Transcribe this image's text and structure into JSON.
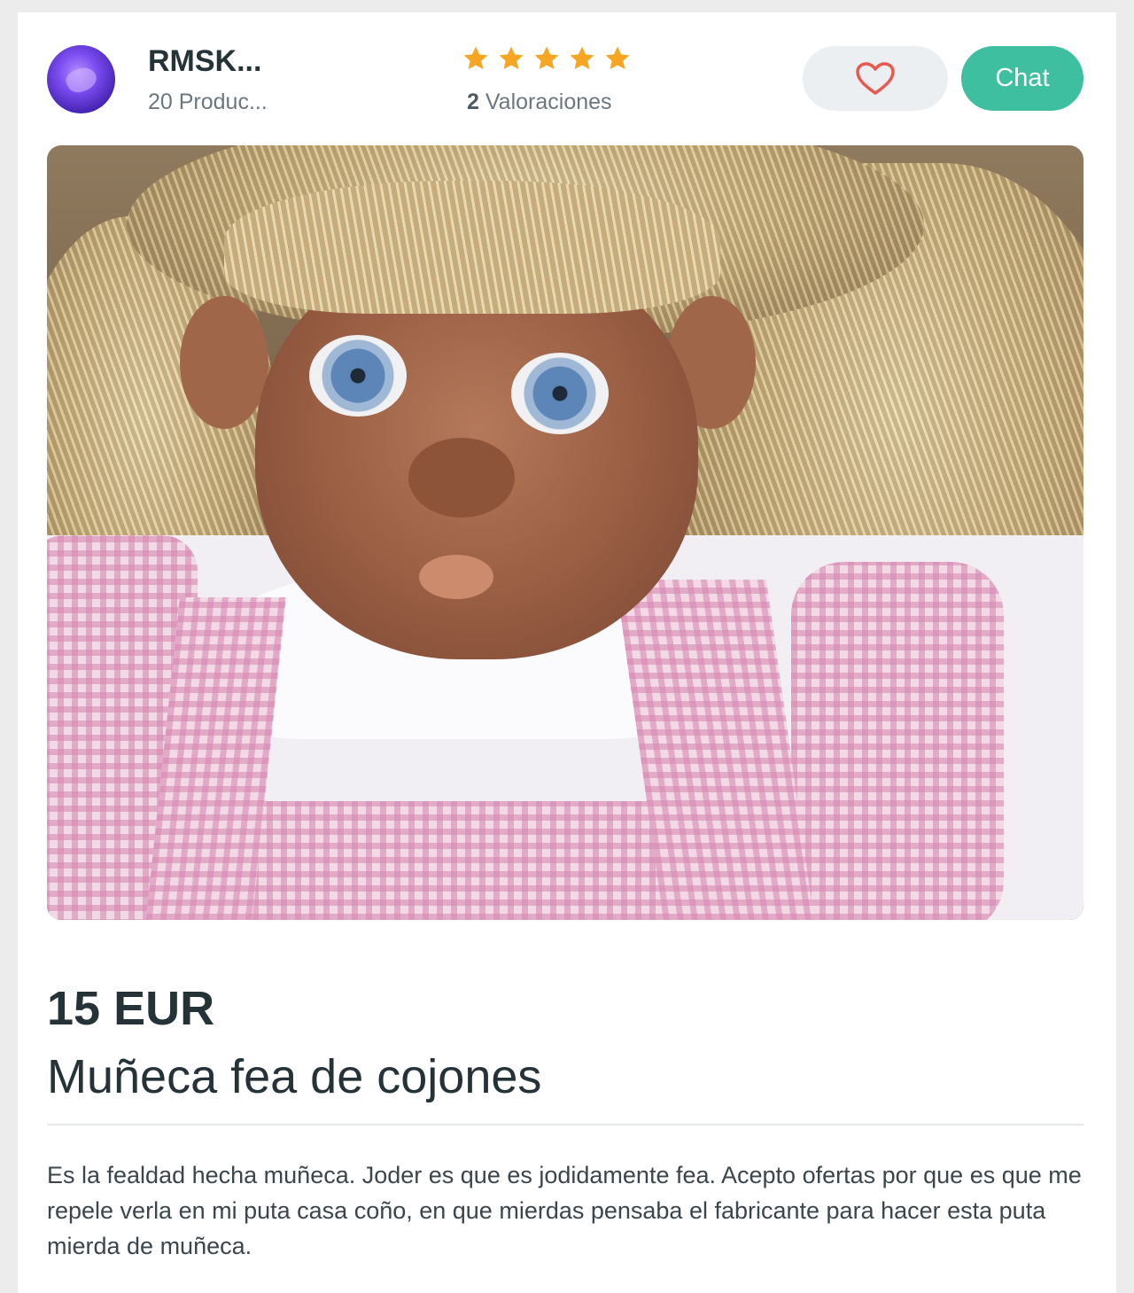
{
  "seller": {
    "name": "RMSK...",
    "products": "20 Produc...",
    "avatar_icon": "avatar-icon"
  },
  "rating": {
    "stars": 5,
    "count": "2",
    "label": "Valoraciones",
    "star_color": "#f5a623"
  },
  "actions": {
    "favorite_icon": "heart-icon",
    "favorite_color": "#e8594f",
    "chat_label": "Chat",
    "chat_color": "#3dbfa0"
  },
  "item": {
    "price": "15 EUR",
    "title": "Muñeca fea de cojones",
    "description": "Es la fealdad hecha muñeca. Joder es que es jodidamente fea. Acepto ofertas por que es que me repele verla en mi puta casa coño, en que mierdas pensaba el fabricante para hacer esta puta mierda de muñeca."
  }
}
